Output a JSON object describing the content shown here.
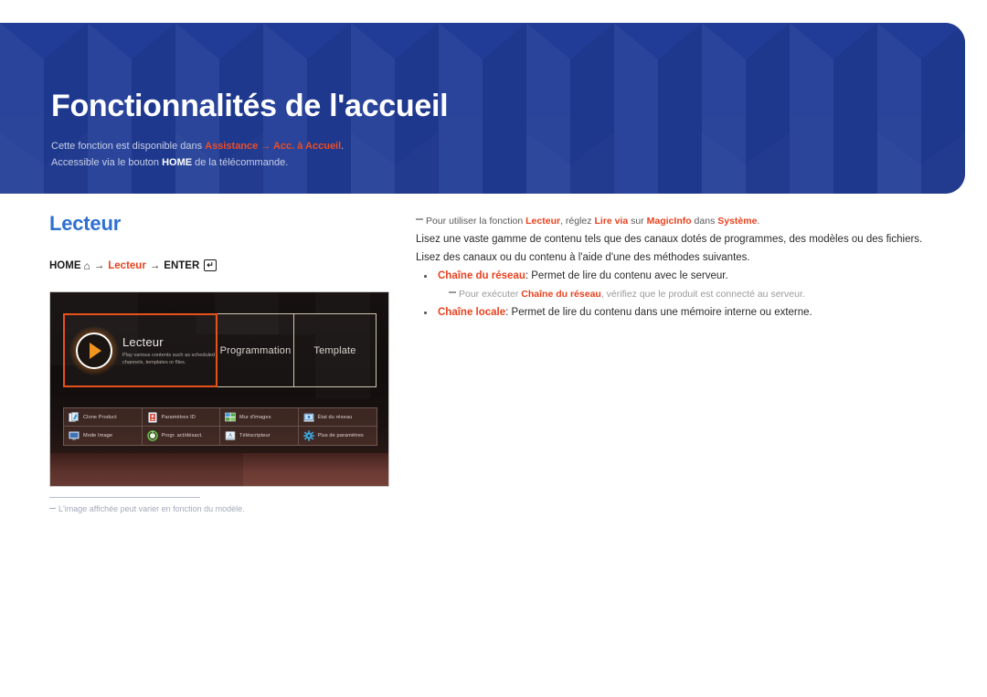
{
  "banner": {
    "title": "Fonctionnalités de l'accueil",
    "sub1_pre": "Cette fonction est disponible dans ",
    "sub1_path1": "Assistance",
    "sub1_arrow": " → ",
    "sub1_path2": "Acc. à Accueil",
    "sub1_post": ".",
    "sub2_pre": "Accessible via le bouton ",
    "sub2_key": "HOME",
    "sub2_post": " de la télécommande.",
    "bg_color": "#203c96",
    "accent_color": "#ef4c23"
  },
  "left": {
    "section_title": "Lecteur",
    "breadcrumb": {
      "home_label": "HOME",
      "home_icon": "home-icon",
      "arrow1": "→",
      "target_label": "Lecteur",
      "arrow2": "→",
      "enter_label": "ENTER",
      "enter_icon": "enter-key-icon"
    },
    "tv": {
      "main_tile": {
        "title": "Lecteur",
        "desc": "Play various contents such as scheduled channels, templates or files.",
        "icon": "play-circle-icon",
        "selected_outline_color": "#e8521a"
      },
      "tiles": [
        {
          "label": "Programmation"
        },
        {
          "label": "Template"
        }
      ],
      "grid": [
        {
          "label": "Clone Product",
          "icon": "clone-product-icon",
          "color": "#e9f0f6"
        },
        {
          "label": "Paramètres ID",
          "icon": "id-settings-icon",
          "color": "#d8554d"
        },
        {
          "label": "Mur d'images",
          "icon": "video-wall-icon",
          "color": "#5aa64f"
        },
        {
          "label": "État du réseau",
          "icon": "network-status-icon",
          "color": "#4c8fd0"
        },
        {
          "label": "Mode Image",
          "icon": "picture-mode-icon",
          "color": "#3f72b8"
        },
        {
          "label": "Progr. act/désact.",
          "icon": "on-off-timer-icon",
          "color": "#63c14a"
        },
        {
          "label": "Téléscripteur",
          "icon": "ticker-icon",
          "color": "#d5dbe2"
        },
        {
          "label": "Plus de paramètres",
          "icon": "gear-icon",
          "color": "#3fa9dd"
        }
      ]
    },
    "footnote": "L'image affichée peut varier en fonction du modèle."
  },
  "right": {
    "note_top": {
      "p1": "Pour utiliser la fonction ",
      "b1": "Lecteur",
      "p2": ", réglez ",
      "b2": "Lire via",
      "p3": " sur ",
      "b3": "MagicInfo",
      "p4": " dans ",
      "b4": "Système",
      "p5": "."
    },
    "line1": "Lisez une vaste gamme de contenu tels que des canaux dotés de programmes, des modèles ou des fichiers.",
    "line2": "Lisez des canaux ou du contenu à l'aide d'une des méthodes suivantes.",
    "bullet1": {
      "term": "Chaîne du réseau",
      "text": ": Permet de lire du contenu avec le serveur."
    },
    "subnote1": {
      "p1": "Pour exécuter ",
      "b1": "Chaîne du réseau",
      "p2": ", vérifiez que le produit est connecté au serveur."
    },
    "bullet2": {
      "term": "Chaîne locale",
      "text": ": Permet de lire du contenu dans une mémoire interne ou externe."
    }
  }
}
